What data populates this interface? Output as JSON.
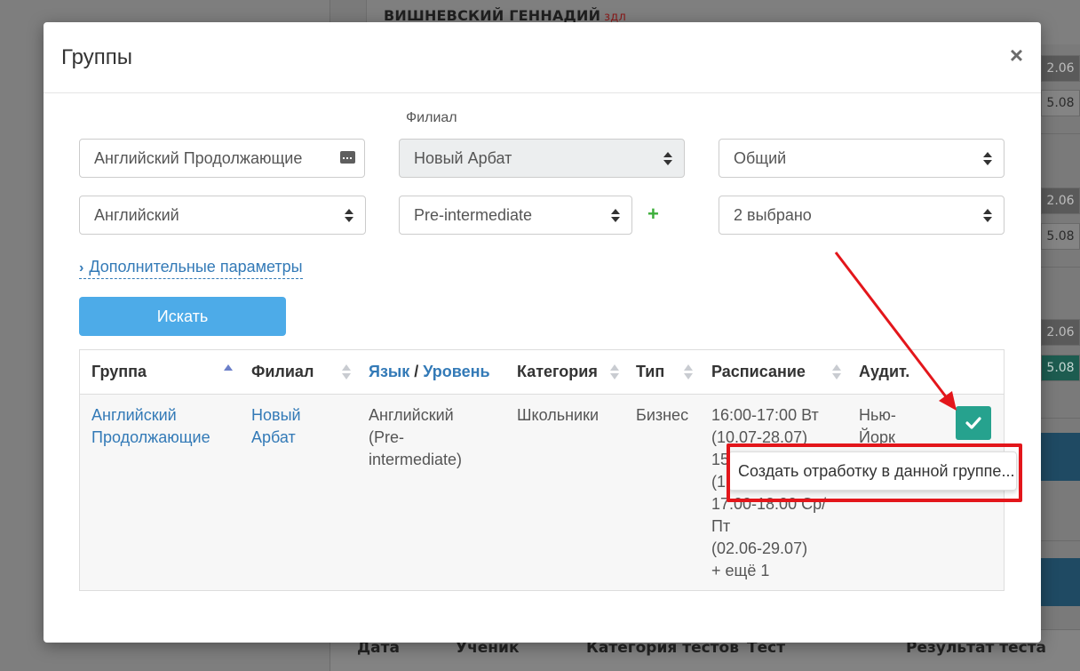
{
  "background": {
    "header_name": "ВИШНЕВСКИЙ ГЕННАДИЙ",
    "header_tag": "здл",
    "cells": [
      "2.06",
      "5.08",
      "2.06",
      "5.08",
      "2.06",
      "5.08"
    ],
    "footer": {
      "date": "Дата",
      "student": "Ученик",
      "test_category": "Категория тестов",
      "test": "Тест",
      "result": "Результат теста"
    }
  },
  "modal": {
    "title": "Группы",
    "close": "×"
  },
  "filters": {
    "branch_label": "Филиал",
    "group_name_value": "Английский Продолжающие",
    "branch_value": "Новый Арбат",
    "type_value": "Общий",
    "language_value": "Английский",
    "level_value": "Pre-intermediate",
    "add_level": "+",
    "category_value": "2 выбрано",
    "advanced_link": "Дополнительные параметры",
    "search_button": "Искать"
  },
  "table": {
    "headers": {
      "group": "Группа",
      "branch": "Филиал",
      "language": "Язык",
      "separator": " / ",
      "level": "Уровень",
      "category": "Категория",
      "type": "Тип",
      "schedule": "Расписание",
      "room": "Аудит."
    },
    "row": {
      "group": "Английский Продолжающие",
      "branch": "Новый Арбат",
      "lang_level": "Английский (Pre-intermediate)",
      "category": "Школьники",
      "type": "Бизнес",
      "schedule_lines": [
        "16:00-17:00 Вт",
        "(10.07-28.07)",
        "15",
        "(1",
        "17:00-18:00 Ср/",
        "Пт",
        "(02.06-29.07)",
        "+ ещё 1"
      ],
      "room": "Нью-Йорк"
    }
  },
  "tooltip": {
    "text": "Создать отработку в данной группе..."
  },
  "colors": {
    "accent_blue": "#337ab7",
    "button_blue": "#4dabe8",
    "check_green": "#26a28e",
    "annotation_red": "#e3161b"
  },
  "icons": {
    "close": "close-icon",
    "check": "checkmark-icon",
    "chevron": "chevron-right-icon",
    "keyboard": "keyboard-icon"
  }
}
